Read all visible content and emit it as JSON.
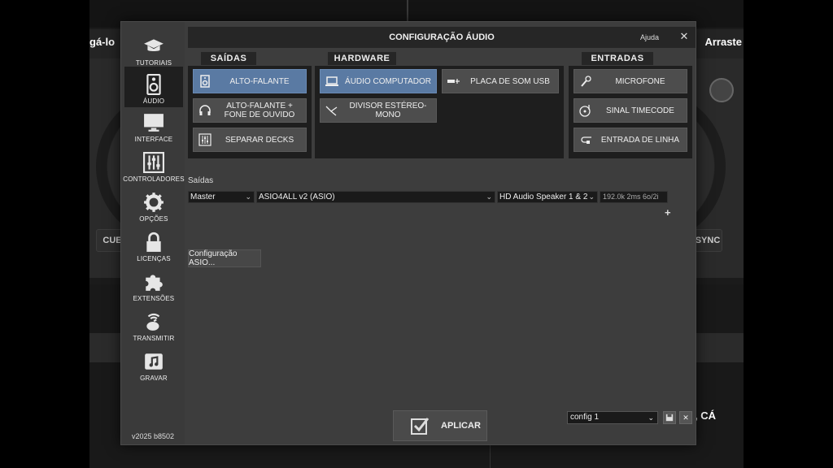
{
  "background": {
    "left_title": "gá-lo",
    "right_title": "Arraste",
    "cue_label": "CUE",
    "sync_label": "SYNC",
    "ca_text": ", CÁ"
  },
  "dialog": {
    "title": "CONFIGURAÇÃO ÁUDIO",
    "help": "Ajuda",
    "close": "✕",
    "version": "v2025 b8502"
  },
  "sidebar": {
    "items": [
      {
        "label": "TUTORIAIS",
        "icon": "graduation-cap-icon"
      },
      {
        "label": "ÁUDIO",
        "icon": "speaker-icon",
        "active": true
      },
      {
        "label": "INTERFACE",
        "icon": "monitor-icon"
      },
      {
        "label": "CONTROLADORES",
        "icon": "sliders-icon"
      },
      {
        "label": "OPÇÕES",
        "icon": "gear-icon"
      },
      {
        "label": "LICENÇAS",
        "icon": "lock-icon"
      },
      {
        "label": "EXTENSÕES",
        "icon": "puzzle-icon"
      },
      {
        "label": "TRANSMITIR",
        "icon": "broadcast-icon"
      },
      {
        "label": "GRAVAR",
        "icon": "music-file-icon"
      }
    ]
  },
  "panels": {
    "saidas": {
      "tab": "SAÍDAS",
      "buttons": [
        {
          "label": "ALTO-FALANTE",
          "icon": "speaker-icon",
          "active": true
        },
        {
          "label": "ALTO-FALANTE + FONE DE OUVIDO",
          "icon": "headphones-icon"
        },
        {
          "label": "SEPARAR DECKS",
          "icon": "mixer-icon"
        }
      ]
    },
    "hardware": {
      "tab": "HARDWARE",
      "buttons": [
        {
          "label": "ÁUDIO COMPUTADOR",
          "icon": "laptop-icon",
          "active": true
        },
        {
          "label": "PLACA DE SOM USB",
          "icon": "usb-icon"
        },
        {
          "label": "DIVISOR ESTÉREO-MONO",
          "icon": "splitter-icon"
        }
      ]
    },
    "entradas": {
      "tab": "ENTRADAS",
      "buttons": [
        {
          "label": "MICROFONE",
          "icon": "microphone-icon"
        },
        {
          "label": "SINAL TIMECODE",
          "icon": "vinyl-icon"
        },
        {
          "label": "ENTRADA DE LINHA",
          "icon": "cable-icon"
        }
      ]
    }
  },
  "outputs": {
    "section_label": "Saídas",
    "channel": "Master",
    "driver": "ASIO4ALL v2 (ASIO)",
    "device": "HD Audio Speaker 1 & 2",
    "info": "192.0k 2ms 6o/2i",
    "add": "+",
    "chevron": "⌄",
    "asio_button": "Configuração ASIO..."
  },
  "footer": {
    "apply": "APLICAR",
    "config_value": "config 1",
    "save_icon": "💾",
    "delete": "✕"
  }
}
